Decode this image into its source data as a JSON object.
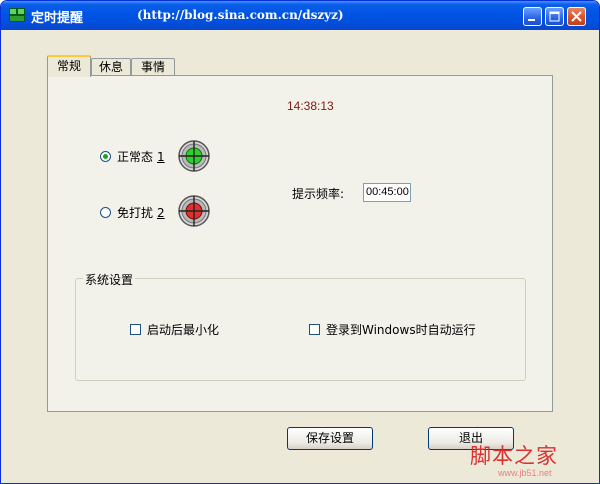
{
  "window": {
    "title": "定时提醒",
    "url": "(http://blog.sina.com.cn/dszyz)",
    "controls": [
      "minimize-icon",
      "maximize-icon",
      "close-icon"
    ],
    "accent_color": "#0054e3"
  },
  "tabs": [
    {
      "label": "常规",
      "active": true
    },
    {
      "label": "休息",
      "active": false
    },
    {
      "label": "事情",
      "active": false
    }
  ],
  "general": {
    "clock": "14:38:13",
    "modes": [
      {
        "label": "正常态",
        "key": "1",
        "checked": true,
        "icon": "green-target-icon",
        "color": "#2fcf2f"
      },
      {
        "label": "免打扰",
        "key": "2",
        "checked": false,
        "icon": "red-target-icon",
        "color": "#e03030"
      }
    ],
    "frequency": {
      "label": "提示频率:",
      "value": "00:45:00"
    }
  },
  "system_settings": {
    "legend": "系统设置",
    "options": [
      {
        "label": "启动后最小化",
        "checked": false
      },
      {
        "label": "登录到Windows时自动运行",
        "checked": false
      }
    ]
  },
  "buttons": {
    "save": "保存设置",
    "exit": "退出"
  },
  "watermark": {
    "text": "脚本之家",
    "sub": "www.jb51.net"
  }
}
